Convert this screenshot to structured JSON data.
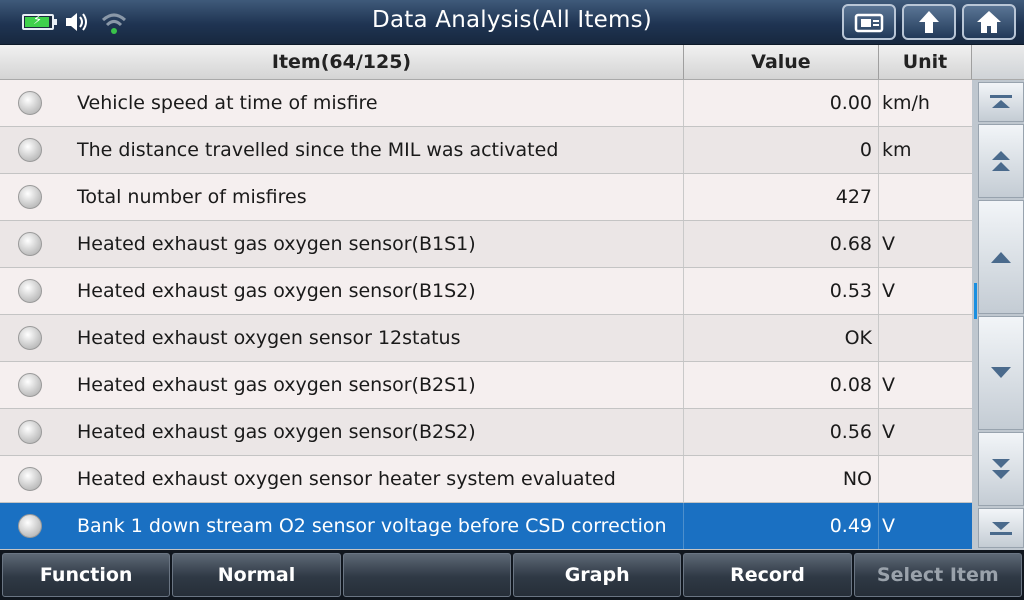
{
  "header": {
    "title": "Data Analysis(All Items)",
    "icons": [
      "battery-charging-icon",
      "speaker-icon",
      "wifi-icon"
    ],
    "buttons": [
      "screenshot-icon",
      "back-arrow-icon",
      "home-icon"
    ]
  },
  "table": {
    "columns": {
      "item": "Item(64/125)",
      "value": "Value",
      "unit": "Unit"
    },
    "rows": [
      {
        "name": "Vehicle speed at time of misfire",
        "value": "0.00",
        "unit": "km/h"
      },
      {
        "name": "The distance travelled since the MIL was activated",
        "value": "0",
        "unit": "km"
      },
      {
        "name": "Total number of misfires",
        "value": "427",
        "unit": ""
      },
      {
        "name": "Heated exhaust gas oxygen sensor(B1S1)",
        "value": "0.68",
        "unit": "V"
      },
      {
        "name": "Heated exhaust gas oxygen sensor(B1S2)",
        "value": "0.53",
        "unit": "V"
      },
      {
        "name": "Heated exhaust oxygen sensor 12status",
        "value": "OK",
        "unit": ""
      },
      {
        "name": "Heated exhaust gas oxygen sensor(B2S1)",
        "value": "0.08",
        "unit": "V"
      },
      {
        "name": "Heated exhaust gas oxygen sensor(B2S2)",
        "value": "0.56",
        "unit": "V"
      },
      {
        "name": "Heated exhaust oxygen sensor heater system evaluated",
        "value": "NO",
        "unit": ""
      },
      {
        "name": "Bank 1 down stream O2 sensor voltage before CSD correction",
        "value": "0.49",
        "unit": "V"
      }
    ],
    "selected_row": 10,
    "selected_color": "#1a70c2"
  },
  "scroll": {
    "buttons": [
      "scroll-top-icon",
      "page-up-icon",
      "up-icon",
      "down-icon",
      "page-down-icon",
      "scroll-bottom-icon"
    ]
  },
  "bottom": {
    "function": "Function",
    "normal": "Normal",
    "empty": "",
    "graph": "Graph",
    "record": "Record",
    "select_item": "Select Item"
  }
}
